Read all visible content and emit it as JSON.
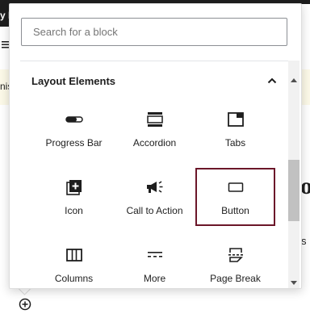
{
  "background": {
    "topbar_fragment": "y P",
    "notice_fragment": "nis",
    "heading_fragment": "o",
    "text_fragment": "s"
  },
  "inserter": {
    "search": {
      "placeholder": "Search for a block",
      "value": ""
    },
    "section": {
      "title": "Layout Elements",
      "expanded": true,
      "blocks": [
        {
          "label": "Progress Bar",
          "icon": "progress-bar-icon"
        },
        {
          "label": "Accordion",
          "icon": "accordion-icon"
        },
        {
          "label": "Tabs",
          "icon": "tabs-icon"
        },
        {
          "label": "Icon",
          "icon": "icon-block-icon"
        },
        {
          "label": "Call to Action",
          "icon": "megaphone-icon"
        },
        {
          "label": "Button",
          "icon": "button-icon",
          "selected": true
        },
        {
          "label": "Columns",
          "icon": "columns-icon"
        },
        {
          "label": "More",
          "icon": "more-icon"
        },
        {
          "label": "Page Break",
          "icon": "page-break-icon"
        }
      ]
    },
    "selection_color": "#6b1629"
  }
}
